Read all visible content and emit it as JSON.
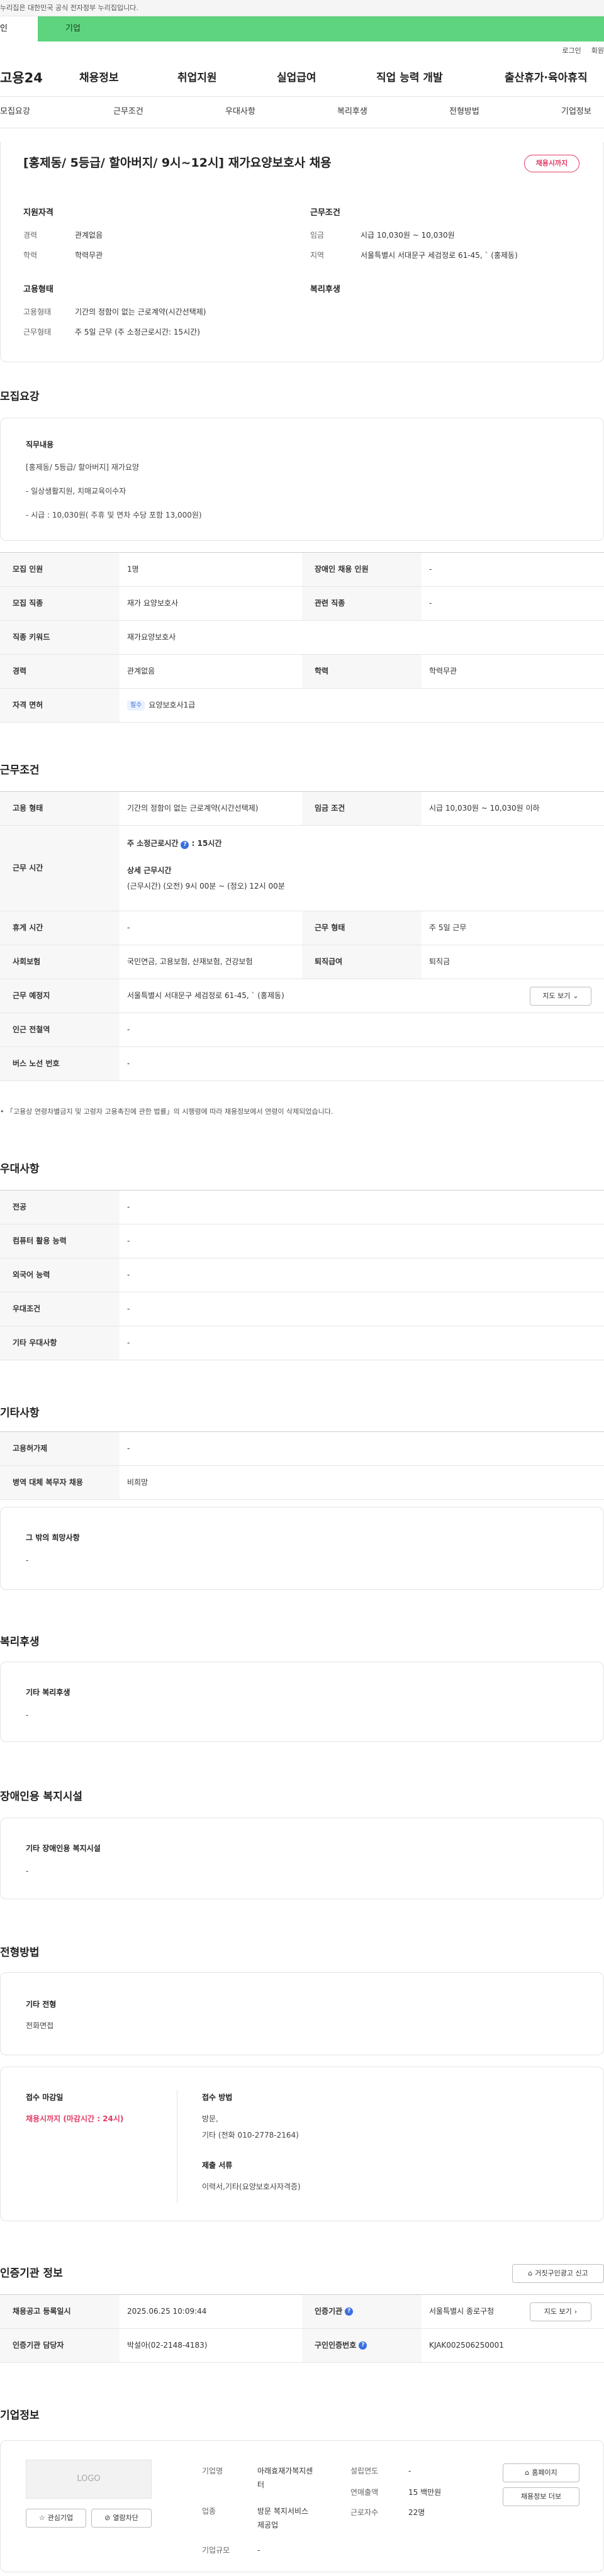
{
  "gov_notice": "이 누리집은 대한민국 공식 전자정부 누리집입니다.",
  "gov_notice_visible": "누리집은 대한민국 공식 전자정부 누리집입니다.",
  "service_tabs": {
    "personal": "인",
    "company": "기업"
  },
  "util_links": {
    "login": "로그인",
    "join": "회원"
  },
  "logo_text": "고용24",
  "gnb": [
    "채용정보",
    "취업지원",
    "실업급여",
    "직업 능력 개발",
    "출산휴가·육아휴직"
  ],
  "sub_nav": [
    "모집요강",
    "근무조건",
    "우대사항",
    "복리후생",
    "전형방법",
    "기업정보"
  ],
  "headline": {
    "title": "[홍제동/ 5등급/ 할아버지/ 9시~12시] 재가요양보호사 채용",
    "status_badge": "채용시까지",
    "req_heading": "지원자격",
    "cond_heading": "근무조건",
    "emp_heading": "고용형태",
    "welfare_heading": "복리후생",
    "career_label": "경력",
    "career_value": "관계없음",
    "edu_label": "학력",
    "edu_value": "학력무관",
    "wage_label": "임금",
    "wage_value": "시급 10,030원 ~ 10,030원",
    "region_label": "지역",
    "region_value": "서울특별시 서대문구 세검정로 61-45, ` (홍제동)",
    "emptype_label": "고용형태",
    "emptype_value": "기간의 정함이 없는 근로계약(시간선택제)",
    "worktype_label": "근무형태",
    "worktype_value": "주 5일 근무 (주 소정근로시간: 15시간)"
  },
  "recruit": {
    "title": "모집요강",
    "duty_heading": "직무내용",
    "duty_lines": [
      "[홍제동/ 5등급/ 할아버지] 재가요양",
      "- 일상생활지원, 치매교육이수자",
      "- 시급 : 10,030원( 주휴 및 연차 수당 포함 13,000원)"
    ],
    "rows": [
      {
        "l1": "모집 인원",
        "v1": "1명",
        "l2": "장애인 채용 인원",
        "v2": "-"
      },
      {
        "l1": "모집 직종",
        "v1": "재가 요양보호사",
        "l2": "관련 직종",
        "v2": "-"
      },
      {
        "l1": "직종 키워드",
        "v1": "재가요양보호사"
      },
      {
        "l1": "경력",
        "v1": "관계없음",
        "l2": "학력",
        "v2": "학력무관"
      },
      {
        "l1": "자격 면허",
        "v1": "요양보호사1급",
        "tag": "필수"
      }
    ]
  },
  "conditions": {
    "title": "근무조건",
    "emp_type_label": "고용 형태",
    "emp_type_value": "기간의 정함이 없는 근로계약(시간선택제)",
    "wage_label": "임금 조건",
    "wage_value": "시급 10,030원 ~ 10,030원 이하",
    "hours_label": "근무 시간",
    "weekly_hours_label": "주 소정근로시간",
    "weekly_hours_value": ": 15시간",
    "detail_hours_label": "상세 근무시간",
    "detail_hours_value": "(근무시간) (오전) 9시 00분 ~ (정오) 12시 00분",
    "rest_label": "휴게 시간",
    "rest_value": "-",
    "shift_label": "근무 형태",
    "shift_value": "주 5일 근무",
    "insurance_label": "사회보험",
    "insurance_value": "국민연금, 고용보험, 산재보험, 건강보험",
    "severance_label": "퇴직급여",
    "severance_value": "퇴직금",
    "location_label": "근무 예정지",
    "location_value": "서울특별시 서대문구 세검정로 61-45, ` (홍제동)",
    "map_button": "지도 보기",
    "subway_label": "인근 전철역",
    "subway_value": "-",
    "bus_label": "버스 노선 번호",
    "bus_value": "-",
    "footnote": "「고용상 연령차별금지 및 고령자 고용촉진에 관한 법률」의 시행령에 따라 채용정보에서 연령이 삭제되었습니다."
  },
  "preference": {
    "title": "우대사항",
    "rows": [
      {
        "label": "전공",
        "value": "-"
      },
      {
        "label": "컴퓨터 활용 능력",
        "value": "-"
      },
      {
        "label": "외국어 능력",
        "value": "-"
      },
      {
        "label": "우대조건",
        "value": "-"
      },
      {
        "label": "기타 우대사항",
        "value": "-"
      }
    ]
  },
  "etc": {
    "title": "기타사항",
    "rows": [
      {
        "label": "고용허가제",
        "value": "-"
      },
      {
        "label": "병역 대체 복무자 채용",
        "value": "비희망"
      }
    ],
    "wish_heading": "그 밖의 희망사항",
    "wish_value": "-"
  },
  "welfare": {
    "title": "복리후생",
    "heading": "기타 복리후생",
    "value": "-"
  },
  "disability": {
    "title": "장애인용 복지시설",
    "heading": "기타 장애인용 복지시설",
    "value": "-"
  },
  "selection": {
    "title": "전형방법",
    "other_heading": "기타 전형",
    "other_value": "전화면접",
    "deadline_heading": "접수 마감일",
    "deadline_value": "채용시까지 (마감시간 : 24시)",
    "method_heading": "접수 방법",
    "method_value1": "방문,",
    "method_value2": "기타 (전화 010-2778-2164)",
    "docs_heading": "제출 서류",
    "docs_value": "이력서,기타(요양보호사자격증)"
  },
  "agency": {
    "title": "인증기관 정보",
    "report_button": "거짓구인광고 신고",
    "rows": [
      {
        "l1": "채용공고 등록일시",
        "v1": "2025.06.25 10:09:44",
        "l2": "인증기관",
        "v2": "서울특별시 종로구청"
      },
      {
        "l1": "인증기관 담당자",
        "v1": "박설아(02-2148-4183)",
        "l2": "구인인증번호",
        "v2": "KJAK002506250001"
      }
    ],
    "map_button": "지도 보기"
  },
  "company": {
    "title": "기업정보",
    "logo_placeholder": "LOGO",
    "interest_button": "관심기업",
    "block_button": "열람차단",
    "name_label": "기업명",
    "name_value_1": "아래효재가복지센",
    "name_value_2": "터",
    "industry_label": "업종",
    "industry_value_1": "방문 복지서비스",
    "industry_value_2": "제공업",
    "size_label": "기업규모",
    "size_value": "-",
    "founded_label": "설립연도",
    "founded_value": "-",
    "sales_label": "연매출액",
    "sales_value": "15 백만원",
    "employees_label": "근로자수",
    "employees_value": "22명",
    "homepage_button": "홈페이지",
    "jobs_button": "채용정보 더보"
  }
}
